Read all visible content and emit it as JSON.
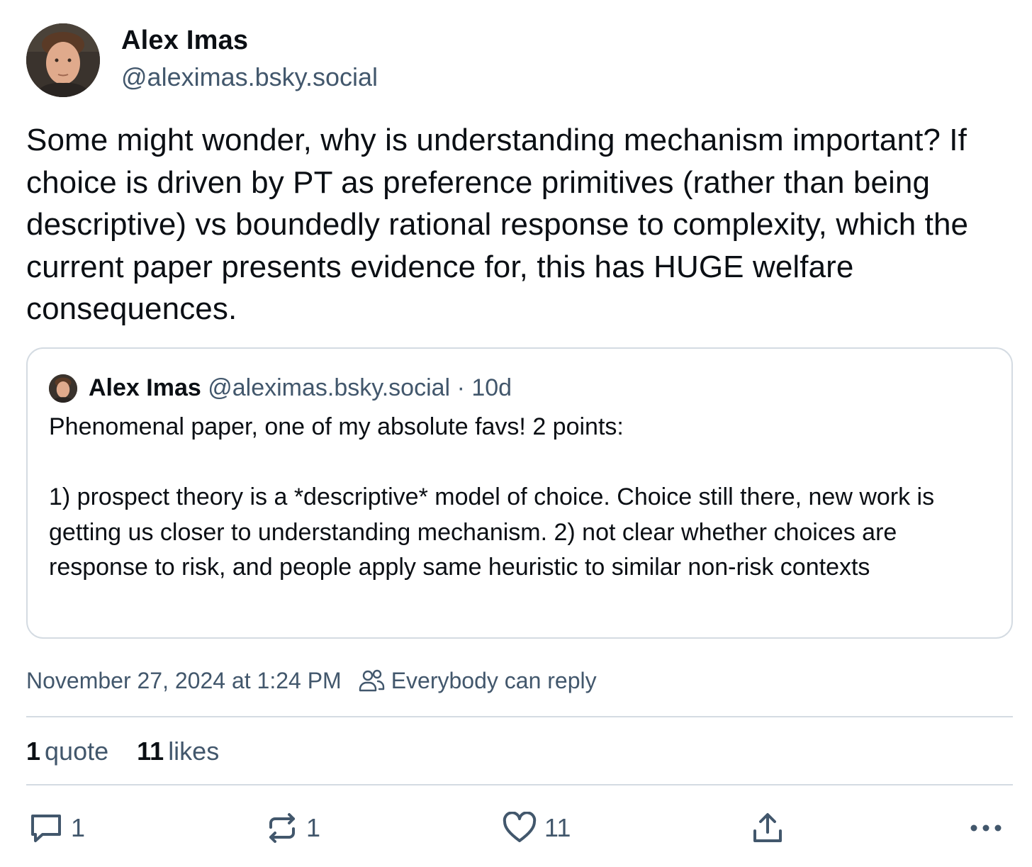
{
  "author": {
    "name": "Alex Imas",
    "handle": "@aleximas.bsky.social"
  },
  "post": {
    "text": "Some might wonder, why is understanding mechanism important? If choice is driven by PT as preference primitives (rather than being descriptive) vs boundedly rational response to complexity, which the current paper presents evidence for, this has HUGE welfare consequences."
  },
  "quoted_post": {
    "name": "Alex Imas",
    "handle": "@aleximas.bsky.social",
    "separator": "·",
    "time": "10d",
    "text": "Phenomenal paper, one of my absolute favs! 2 points:\n\n1) prospect theory is a *descriptive* model of choice. Choice still there, new work is getting us closer to understanding mechanism. 2) not clear whether choices are response to risk, and people apply same heuristic to similar non-risk contexts"
  },
  "meta": {
    "timestamp": "November 27, 2024 at 1:24 PM",
    "reply_setting": "Everybody can reply",
    "reply_icon": "people-icon"
  },
  "stats": {
    "quotes_count": "1",
    "quotes_label": "quote",
    "likes_count": "11",
    "likes_label": "likes"
  },
  "actions": {
    "reply_count": "1",
    "repost_count": "1",
    "like_count": "11",
    "icons": [
      "reply-icon",
      "repost-icon",
      "like-icon",
      "share-icon",
      "more-icon"
    ]
  },
  "colors": {
    "text_primary": "#0b0f14",
    "text_secondary": "#42576c",
    "border": "#d4dbe2"
  }
}
